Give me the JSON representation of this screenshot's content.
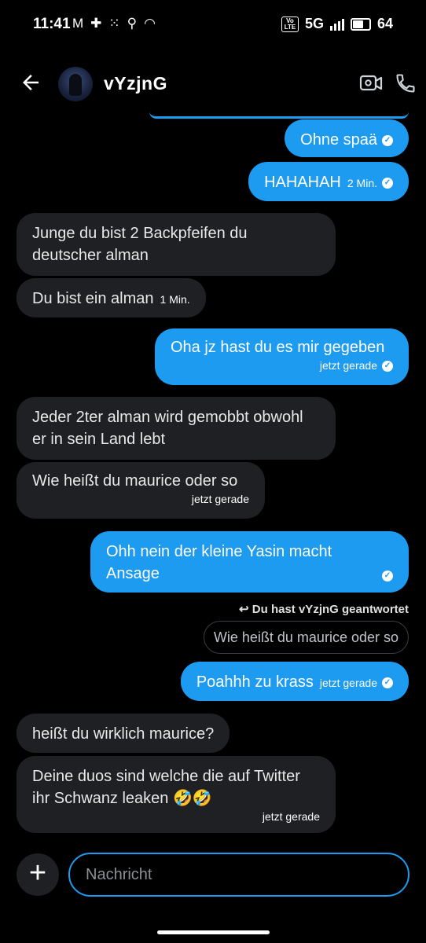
{
  "status": {
    "time": "11:41",
    "network": "5G",
    "battery": "64",
    "volte": "Vo\nLTE"
  },
  "header": {
    "name": "vYzjnG"
  },
  "messages": [
    {
      "dir": "out",
      "text": "Ohne spaä",
      "meta": ""
    },
    {
      "dir": "out",
      "text": "HAHAHAH",
      "meta": "2 Min."
    },
    {
      "dir": "in",
      "text": "Junge du bist 2 Backpfeifen du deutscher alman",
      "meta": ""
    },
    {
      "dir": "in",
      "text": "Du bist ein alman",
      "meta": "1 Min."
    },
    {
      "dir": "out",
      "text": "Oha jz hast du es mir gegeben",
      "meta": "jetzt gerade"
    },
    {
      "dir": "in",
      "text": "Jeder 2ter alman wird gemobbt obwohl er in sein Land lebt",
      "meta": ""
    },
    {
      "dir": "in",
      "text": "Wie heißt du maurice oder so",
      "meta": "jetzt gerade"
    },
    {
      "dir": "out",
      "text": "Ohh nein der kleine Yasin macht Ansage",
      "meta": ""
    },
    {
      "dir": "out",
      "text": "Poahhh zu krass",
      "meta": "jetzt gerade"
    },
    {
      "dir": "in",
      "text": "heißt du wirklich maurice?",
      "meta": ""
    },
    {
      "dir": "in",
      "text": "Deine duos sind welche die auf Twitter ihr Schwanz leaken 🤣🤣",
      "meta": "jetzt gerade"
    }
  ],
  "reply": {
    "note": "Du hast vYzjnG geantwortet",
    "quoted": "Wie heißt du maurice oder so"
  },
  "composer": {
    "placeholder": "Nachricht"
  },
  "icons": {
    "back": "back-arrow-icon",
    "video": "video-call-icon",
    "phone": "phone-call-icon",
    "plus": "plus-icon",
    "read": "read-check-icon"
  },
  "colors": {
    "outgoing": "#1d9bf0",
    "incoming": "#1f2023",
    "background": "#000000"
  }
}
